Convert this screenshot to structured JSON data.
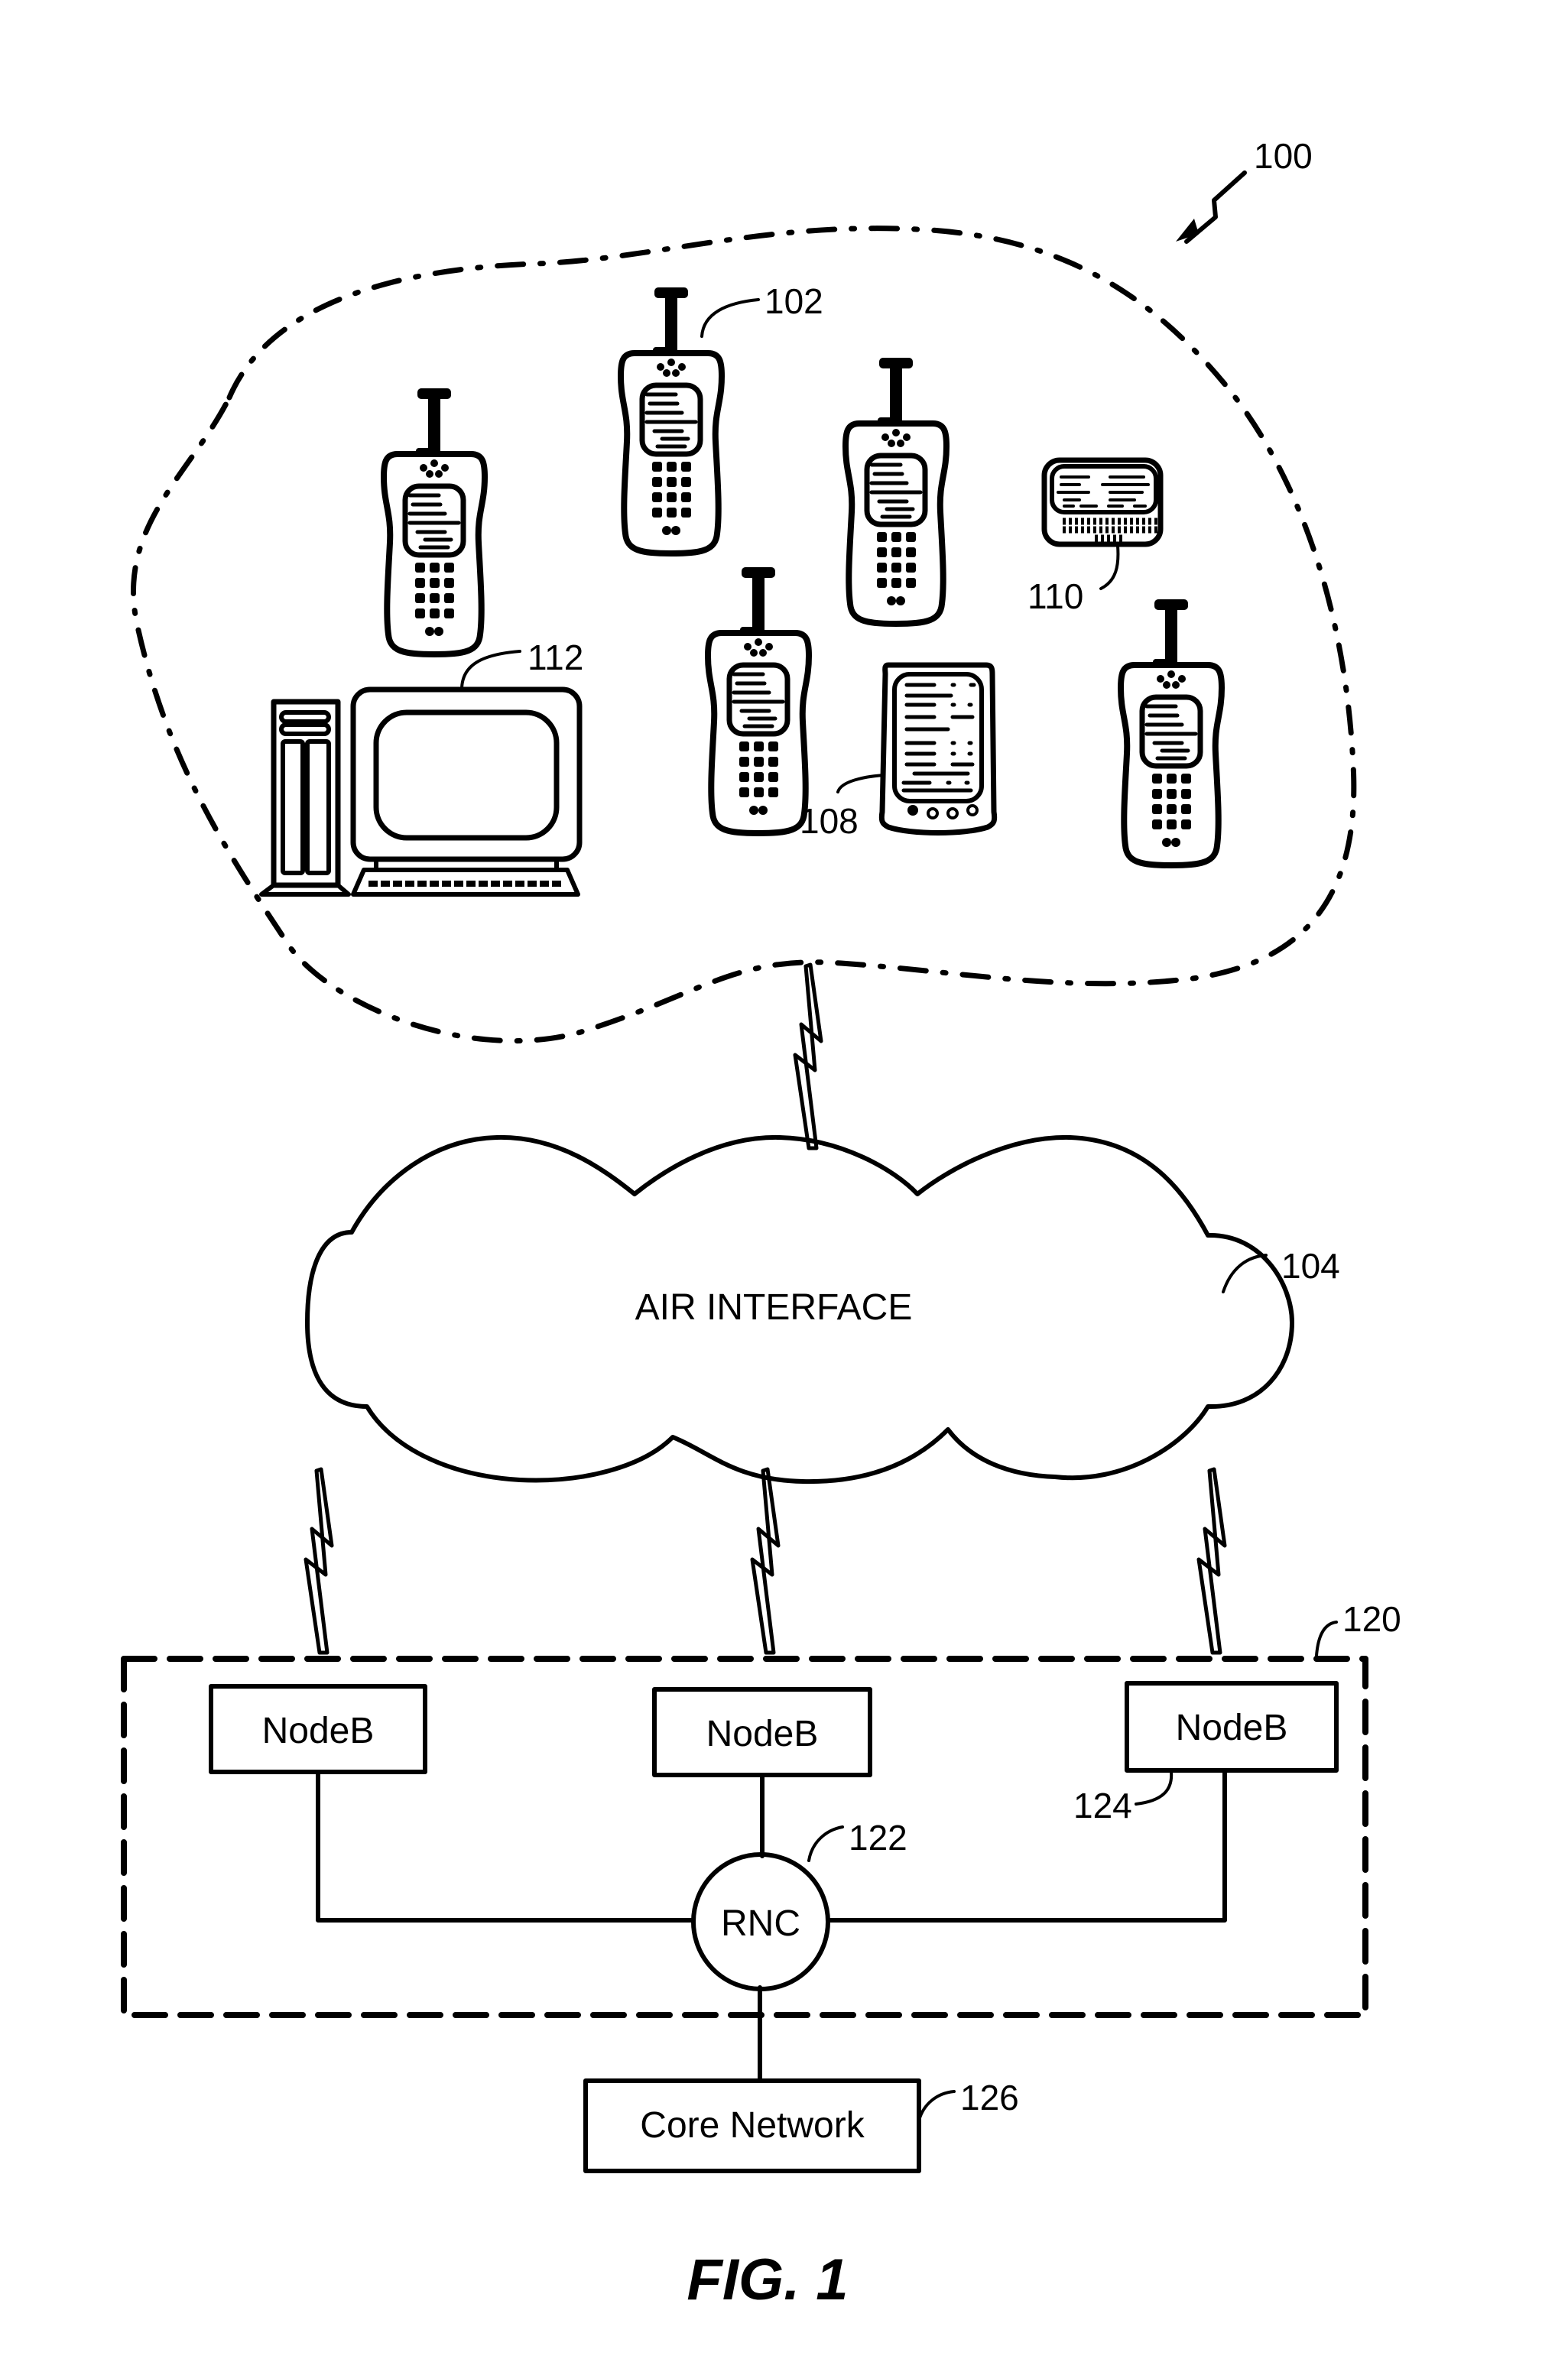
{
  "figure": {
    "caption": "FIG. 1",
    "system_ref": "100"
  },
  "coverage_area": {
    "devices": [
      {
        "type": "mobile-phone",
        "ref": "102"
      },
      {
        "type": "mobile-phone",
        "ref": ""
      },
      {
        "type": "mobile-phone",
        "ref": ""
      },
      {
        "type": "mobile-phone",
        "ref": ""
      },
      {
        "type": "mobile-phone",
        "ref": ""
      },
      {
        "type": "pager",
        "ref": "110"
      },
      {
        "type": "pda",
        "ref": "108"
      },
      {
        "type": "desktop-computer",
        "ref": "112"
      }
    ],
    "refs": {
      "phone": "102",
      "pager": "110",
      "pda": "108",
      "computer": "112"
    }
  },
  "air_interface": {
    "label": "AIR INTERFACE",
    "ref": "104"
  },
  "ran": {
    "ref": "120",
    "nodeb_label": "NodeB",
    "nodeb_ref": "124",
    "nodebs": [
      "NodeB",
      "NodeB",
      "NodeB"
    ],
    "rnc_label": "RNC",
    "rnc_ref": "122"
  },
  "core_network": {
    "label": "Core Network",
    "ref": "126"
  }
}
